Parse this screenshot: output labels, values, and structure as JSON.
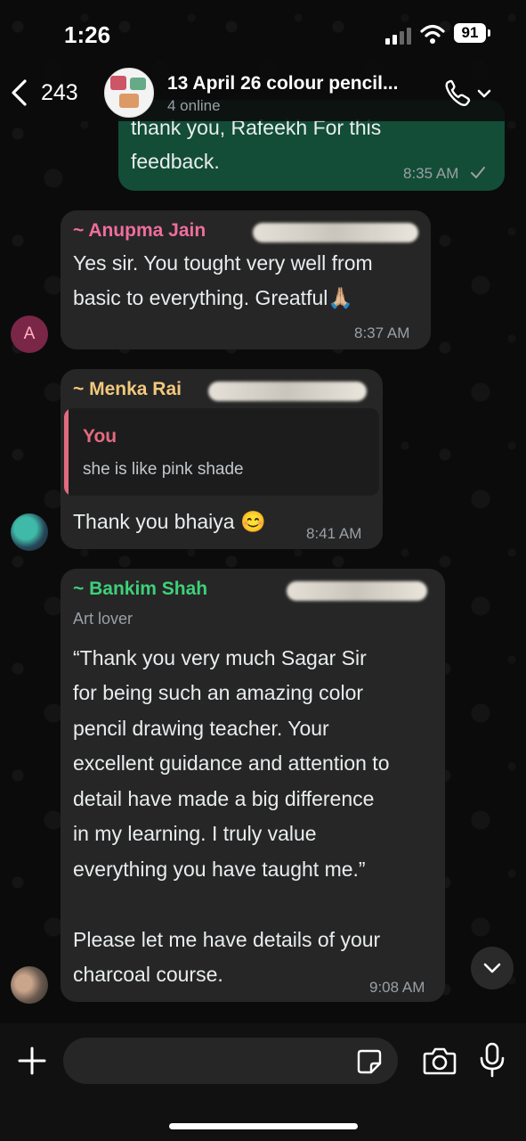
{
  "status_bar": {
    "time": "1:26",
    "battery": "91"
  },
  "header": {
    "back_count": "243",
    "title": "13 April 26 colour pencil...",
    "subtitle": "4 online"
  },
  "messages": [
    {
      "direction": "outgoing",
      "text_line1": "thank you, Rafeekh For this",
      "text_line2": "feedback.",
      "time": "8:35 AM",
      "status_icon": "read-check-icon"
    },
    {
      "direction": "incoming",
      "sender": "~ Anupma  Jain",
      "sender_color": "#f06d9c",
      "text_line1": "Yes sir. You tought very well from",
      "text_line2": "basic to everything. Greatful",
      "emoji": "🙏🏼",
      "time": "8:37 AM",
      "avatar_letter": "A",
      "avatar_color": "#7a2646"
    },
    {
      "direction": "incoming",
      "sender": "~ Menka Rai",
      "sender_color": "#f2c97d",
      "quote_author": "You",
      "quote_text": "she is like pink shade",
      "text": "Thank you bhaiya",
      "emoji": "😊",
      "time": "8:41 AM"
    },
    {
      "direction": "incoming",
      "sender": "~ Bankim Shah",
      "sender_color": "#3ed07a",
      "sender_note": "Art lover",
      "lines": [
        "“Thank you very much Sagar Sir",
        "for being such an amazing color",
        "pencil drawing teacher. Your",
        "excellent guidance and attention to",
        "detail have made a big difference",
        "in my learning. I truly value",
        "everything you have taught me.”",
        "",
        "Please let me have details of your",
        "charcoal course."
      ],
      "time": "9:08 AM"
    }
  ],
  "composer": {
    "placeholder": ""
  },
  "colors": {
    "outgoing_bubble": "#134d37",
    "incoming_bubble": "#262626",
    "background": "#0b0b0b"
  }
}
